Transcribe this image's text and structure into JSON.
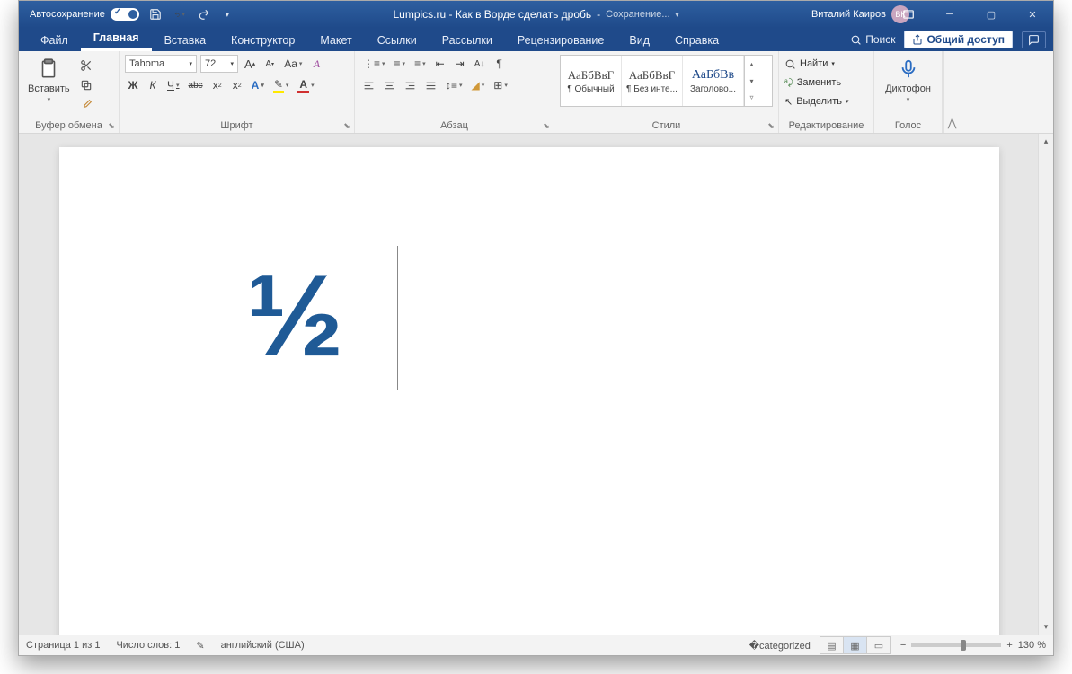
{
  "titlebar": {
    "autosave": "Автосохранение",
    "doc_title": "Lumpics.ru - Как в Ворде сделать дробь",
    "saving": "Сохранение...",
    "user_name": "Виталий Каиров",
    "user_initials": "ВК"
  },
  "tabs": {
    "items": [
      "Файл",
      "Главная",
      "Вставка",
      "Конструктор",
      "Макет",
      "Ссылки",
      "Рассылки",
      "Рецензирование",
      "Вид",
      "Справка"
    ],
    "search": "Поиск",
    "share": "Общий доступ"
  },
  "ribbon": {
    "clipboard": {
      "paste": "Вставить",
      "label": "Буфер обмена"
    },
    "font": {
      "name": "Tahoma",
      "size": "72",
      "bold": "Ж",
      "italic": "К",
      "underline": "Ч",
      "strike": "abc",
      "label": "Шрифт"
    },
    "paragraph": {
      "label": "Абзац"
    },
    "styles": {
      "preview": "АаБбВвГ",
      "items": [
        "¶ Обычный",
        "¶ Без инте...",
        "Заголово..."
      ],
      "label": "Стили"
    },
    "editing": {
      "find": "Найти",
      "replace": "Заменить",
      "select": "Выделить",
      "label": "Редактирование"
    },
    "voice": {
      "dictate": "Диктофон",
      "label": "Голос"
    }
  },
  "document": {
    "content": "½"
  },
  "status": {
    "page": "Страница 1 из 1",
    "words": "Число слов: 1",
    "lang": "английский (США)",
    "zoom": "130 %"
  }
}
